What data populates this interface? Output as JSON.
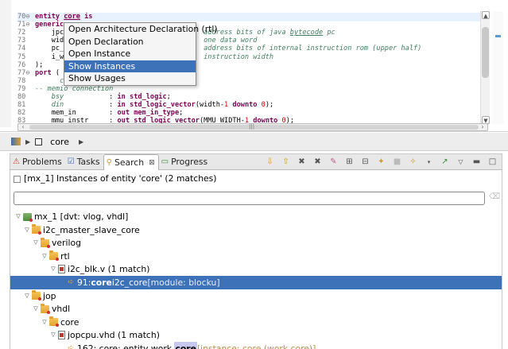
{
  "editor": {
    "lines": [
      {
        "n": "70",
        "fold": "⊖",
        "parts": [
          [
            "kw",
            "entity "
          ],
          [
            "ul",
            "core"
          ],
          [
            "kw",
            " is"
          ]
        ]
      },
      {
        "n": "71",
        "fold": "⊖",
        "parts": [
          [
            "kw",
            "generic"
          ]
        ]
      },
      {
        "n": "72",
        "fold": "",
        "parts": [
          [
            "",
            "    jpc"
          ],
          [
            "cm",
            "                                  address bits of java "
          ],
          [
            "cmu",
            "bytecode"
          ],
          [
            "cm",
            " pc"
          ]
        ]
      },
      {
        "n": "73",
        "fold": "",
        "parts": [
          [
            "",
            "    wid"
          ],
          [
            "cm",
            "                                  one data word"
          ]
        ]
      },
      {
        "n": "74",
        "fold": "",
        "parts": [
          [
            "",
            "    pc_"
          ],
          [
            "cm",
            "                                  address bits of internal instruction rom (upper half)"
          ]
        ]
      },
      {
        "n": "75",
        "fold": "",
        "parts": [
          [
            "",
            "    i_w"
          ],
          [
            "cm",
            "                                  instruction width"
          ]
        ]
      },
      {
        "n": "76",
        "fold": "",
        "parts": [
          [
            "",
            ");"
          ]
        ]
      },
      {
        "n": "77",
        "fold": "⊖",
        "parts": [
          [
            "kw",
            "port"
          ],
          [
            "",
            " ("
          ]
        ]
      },
      {
        "n": "78",
        "fold": "",
        "parts": [
          [
            "cm",
            "      clk"
          ]
        ]
      },
      {
        "n": "79",
        "fold": "",
        "parts": [
          [
            "cm",
            "-- memio connection"
          ]
        ]
      },
      {
        "n": "80",
        "fold": "",
        "parts": [
          [
            "cm",
            "    bsy"
          ],
          [
            "",
            " "
          ],
          [
            "",
            "          : "
          ],
          [
            "kw",
            "in"
          ],
          [
            "",
            " "
          ],
          [
            "kw",
            "std_logic"
          ],
          [
            "",
            ";"
          ]
        ]
      },
      {
        "n": "81",
        "fold": "",
        "parts": [
          [
            "cm",
            "    din"
          ],
          [
            "",
            "           : "
          ],
          [
            "kw",
            "in"
          ],
          [
            "",
            " "
          ],
          [
            "kw",
            "std_logic_vector"
          ],
          [
            "",
            "(width-"
          ],
          [
            "num",
            "1"
          ],
          [
            "",
            " "
          ],
          [
            "kw",
            "downto"
          ],
          [
            "",
            " "
          ],
          [
            "num",
            "0"
          ],
          [
            "",
            ");"
          ]
        ]
      },
      {
        "n": "82",
        "fold": "",
        "parts": [
          [
            "",
            "    mem_in        : "
          ],
          [
            "kw",
            "out"
          ],
          [
            "",
            " "
          ],
          [
            "kw",
            "mem_in_type"
          ],
          [
            "",
            ";"
          ]
        ]
      },
      {
        "n": "83",
        "fold": "",
        "parts": [
          [
            "",
            "    mmu_instr     : "
          ],
          [
            "kw",
            "out"
          ],
          [
            "",
            " "
          ],
          [
            "kw",
            "std_logic_vector"
          ],
          [
            "",
            "(MMU_WIDTH-"
          ],
          [
            "num",
            "1"
          ],
          [
            "",
            " "
          ],
          [
            "kw",
            "downto"
          ],
          [
            "",
            " "
          ],
          [
            "num",
            "0"
          ],
          [
            "",
            ");"
          ]
        ]
      }
    ]
  },
  "context_menu": {
    "items": [
      {
        "label": "Open Architecture Declaration (rtl)",
        "selected": false
      },
      {
        "label": "Open Declaration",
        "selected": false
      },
      {
        "label": "Open Instance",
        "selected": false
      },
      {
        "label": "Show Instances",
        "selected": true
      },
      {
        "label": "Show Usages",
        "selected": false
      }
    ]
  },
  "breadcrumb": {
    "item": "core"
  },
  "tabs": [
    {
      "label": "Problems",
      "icon": "problems-icon",
      "active": false
    },
    {
      "label": "Tasks",
      "icon": "tasks-icon",
      "active": false
    },
    {
      "label": "Search",
      "icon": "search-icon",
      "active": true
    },
    {
      "label": "Progress",
      "icon": "progress-icon",
      "active": false
    }
  ],
  "search": {
    "summary": "[mx_1] Instances of entity 'core' (2 matches)",
    "filter_value": ""
  },
  "tree": [
    {
      "depth": 0,
      "icon": "project-icon",
      "text": "mx_1 [dvt: vlog, vhdl]"
    },
    {
      "depth": 1,
      "icon": "folder-icon",
      "text": "i2c_master_slave_core"
    },
    {
      "depth": 2,
      "icon": "folder-icon",
      "text": "verilog"
    },
    {
      "depth": 3,
      "icon": "folder-icon",
      "text": "rtl"
    },
    {
      "depth": 4,
      "icon": "file-icon",
      "text": "i2c_blk.v (1 match)"
    },
    {
      "depth": 5,
      "icon": "match-icon",
      "prefix": "91: ",
      "bold": "core",
      "rest": " i2c_core",
      "tag": " [module: blocku]",
      "selected": true
    },
    {
      "depth": 1,
      "icon": "folder-icon",
      "text": "jop"
    },
    {
      "depth": 2,
      "icon": "folder-icon",
      "text": "vhdl"
    },
    {
      "depth": 3,
      "icon": "folder-icon",
      "text": "core"
    },
    {
      "depth": 4,
      "icon": "file-icon",
      "text": "jopcpu.vhd (1 match)"
    },
    {
      "depth": 5,
      "icon": "match-icon",
      "prefix": "162: core: entity work.",
      "bold": "core",
      "rest": "",
      "tag": " [instance: core (work.core)]",
      "selected": false
    }
  ],
  "colors": {
    "selection": "#3d72b8",
    "keyword": "#7f0055",
    "comment": "#3f7f5f"
  }
}
